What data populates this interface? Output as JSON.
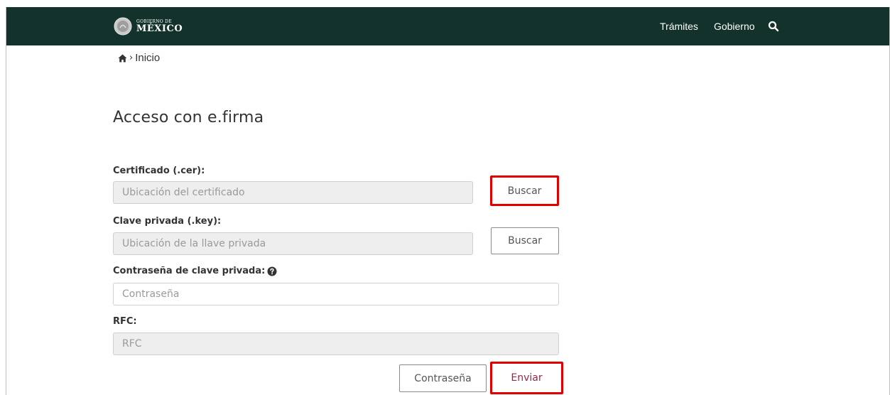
{
  "header": {
    "logo_small": "GOBIERNO DE",
    "logo_big": "MÉXICO",
    "nav_links": [
      "Trámites",
      "Gobierno"
    ],
    "search_icon": "search-icon"
  },
  "breadcrumb": {
    "home_icon": "home-icon",
    "separator": "›",
    "current": "Inicio"
  },
  "page": {
    "title": "Acceso con e.firma"
  },
  "form": {
    "certificate": {
      "label": "Certificado (.cer):",
      "placeholder": "Ubicación del certificado",
      "button": "Buscar"
    },
    "private_key": {
      "label": "Clave privada (.key):",
      "placeholder": "Ubicación de la llave privada",
      "button": "Buscar"
    },
    "password": {
      "label": "Contraseña de clave privada:",
      "placeholder": "Contraseña",
      "help_icon": "question-circle-icon"
    },
    "rfc": {
      "label": "RFC:",
      "placeholder": "RFC"
    },
    "actions": {
      "password_button": "Contraseña",
      "submit_button": "Enviar"
    }
  },
  "colors": {
    "navbar": "#13322b",
    "highlight": "#e00000",
    "primary_text": "#9d2449"
  }
}
